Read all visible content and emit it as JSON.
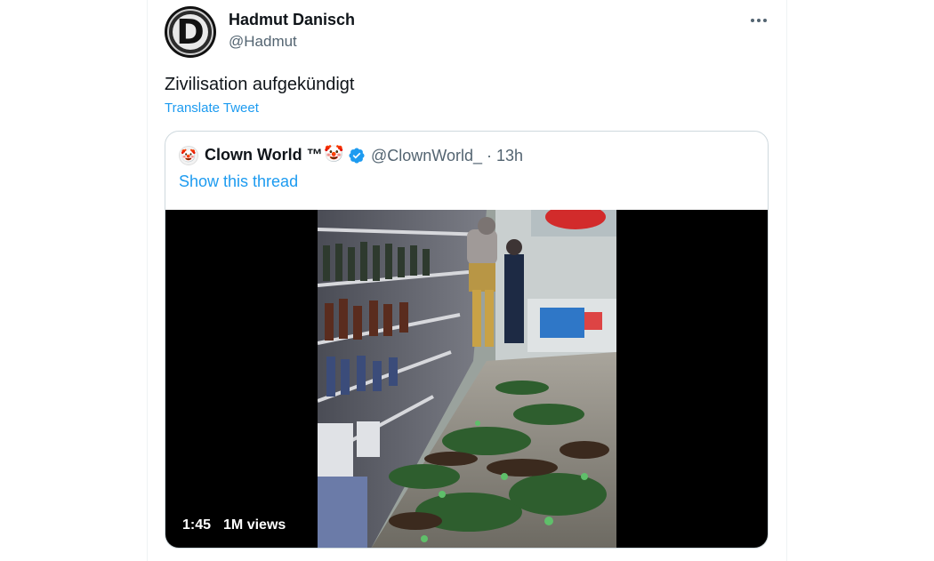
{
  "author": {
    "name": "Hadmut Danisch",
    "handle": "@Hadmut",
    "avatar_letter": "D"
  },
  "tweet": {
    "text": "Zivilisation aufgekündigt",
    "translate_label": "Translate Tweet"
  },
  "quoted": {
    "name": "Clown World ™",
    "emoji": "🤡",
    "handle_time": "@ClownWorld_ · 13h",
    "show_thread_label": "Show this thread",
    "avatar_emoji": "🤡"
  },
  "video": {
    "duration": "1:45",
    "views": "1M views"
  },
  "colors": {
    "link": "#1d9bf0",
    "verified": "#1d9bf0",
    "secondary_text": "#536471",
    "border": "#cfd9de"
  },
  "icons": {
    "more": "more-horizontal-icon",
    "verified": "verified-badge-icon"
  }
}
